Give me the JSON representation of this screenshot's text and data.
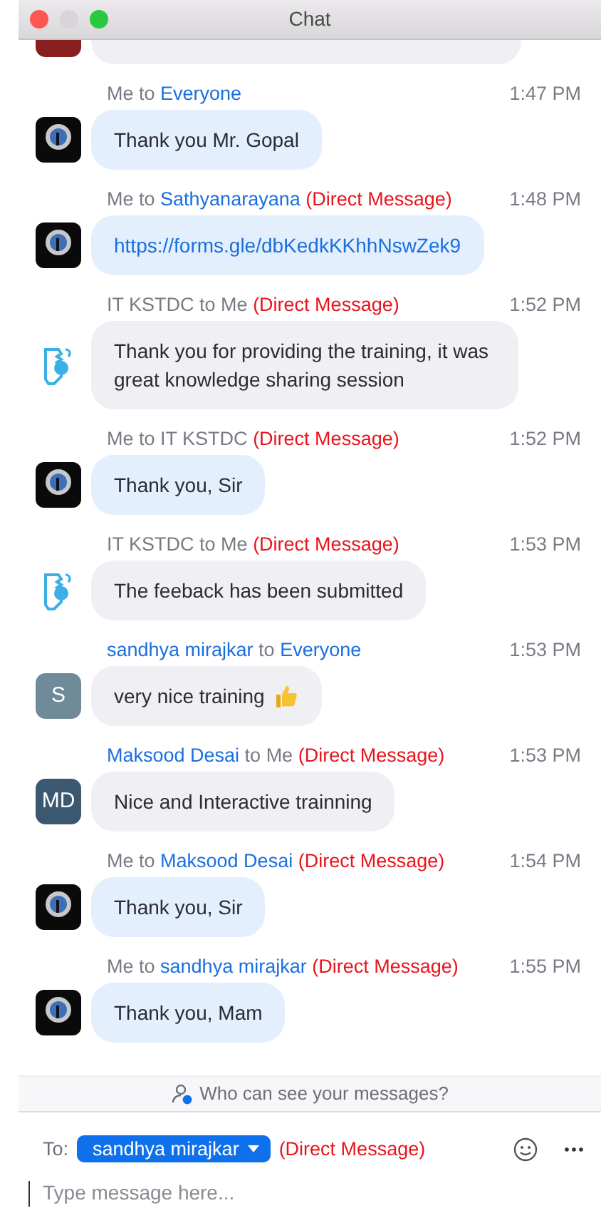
{
  "window": {
    "title": "Chat"
  },
  "cut_message": {
    "avatar": {
      "kind": "photo"
    },
    "kind": "received"
  },
  "messages": [
    {
      "from": {
        "name": "Me",
        "highlight": false
      },
      "connector": "to",
      "to": {
        "name": "Everyone",
        "highlight": true
      },
      "direct": false,
      "time": "1:47 PM",
      "avatar": {
        "kind": "logo"
      },
      "kind": "sent",
      "text": "Thank you Mr. Gopal"
    },
    {
      "from": {
        "name": "Me",
        "highlight": false
      },
      "connector": "to",
      "to": {
        "name": "Sathyanarayana",
        "highlight": true
      },
      "direct": true,
      "direct_label": "(Direct Message)",
      "time": "1:48 PM",
      "avatar": {
        "kind": "logo"
      },
      "kind": "link",
      "text": "https://forms.gle/dbKedkKKhhNswZek9"
    },
    {
      "from": {
        "name": "IT KSTDC",
        "highlight": false
      },
      "connector": "to",
      "to": {
        "name": "Me",
        "highlight": false
      },
      "direct": true,
      "direct_label": "(Direct Message)",
      "time": "1:52 PM",
      "avatar": {
        "kind": "shield"
      },
      "kind": "received",
      "text": "Thank you for providing the training, it was great knowledge sharing session"
    },
    {
      "from": {
        "name": "Me",
        "highlight": false
      },
      "connector": "to",
      "to": {
        "name": "IT KSTDC",
        "highlight": false
      },
      "direct": true,
      "direct_label": "(Direct Message)",
      "time": "1:52 PM",
      "avatar": {
        "kind": "logo"
      },
      "kind": "sent",
      "text": "Thank you, Sir"
    },
    {
      "from": {
        "name": "IT KSTDC",
        "highlight": false
      },
      "connector": "to",
      "to": {
        "name": "Me",
        "highlight": false
      },
      "direct": true,
      "direct_label": "(Direct Message)",
      "time": "1:53 PM",
      "avatar": {
        "kind": "shield"
      },
      "kind": "received",
      "text": "The feeback has been submitted"
    },
    {
      "from": {
        "name": "sandhya mirajkar",
        "highlight": true
      },
      "connector": "to",
      "to": {
        "name": "Everyone",
        "highlight": true
      },
      "direct": false,
      "time": "1:53 PM",
      "avatar": {
        "kind": "initials",
        "initials": "S",
        "color": "#6f8a99"
      },
      "kind": "received",
      "text": "very nice training",
      "trailing_icon": {
        "kind": "thumbs-up"
      }
    },
    {
      "from": {
        "name": "Maksood Desai",
        "highlight": true
      },
      "connector": "to",
      "to": {
        "name": "Me",
        "highlight": false
      },
      "direct": true,
      "direct_label": "(Direct Message)",
      "time": "1:53 PM",
      "avatar": {
        "kind": "initials",
        "initials": "MD",
        "color": "#3b5870"
      },
      "kind": "received",
      "text": "Nice and Interactive trainning"
    },
    {
      "from": {
        "name": "Me",
        "highlight": false
      },
      "connector": "to",
      "to": {
        "name": "Maksood Desai",
        "highlight": true
      },
      "direct": true,
      "direct_label": "(Direct Message)",
      "time": "1:54 PM",
      "avatar": {
        "kind": "logo"
      },
      "kind": "sent",
      "text": "Thank you, Sir"
    },
    {
      "from": {
        "name": "Me",
        "highlight": false
      },
      "connector": "to",
      "to": {
        "name": "sandhya mirajkar",
        "highlight": true
      },
      "direct": true,
      "direct_label": "(Direct Message)",
      "time": "1:55 PM",
      "avatar": {
        "kind": "logo"
      },
      "kind": "sent",
      "text": "Thank you, Mam"
    }
  ],
  "visibility_link": "Who can see your messages?",
  "composer": {
    "to_label": "To:",
    "recipient": "sandhya mirajkar",
    "direct_label": "(Direct Message)",
    "placeholder": "Type message here..."
  }
}
